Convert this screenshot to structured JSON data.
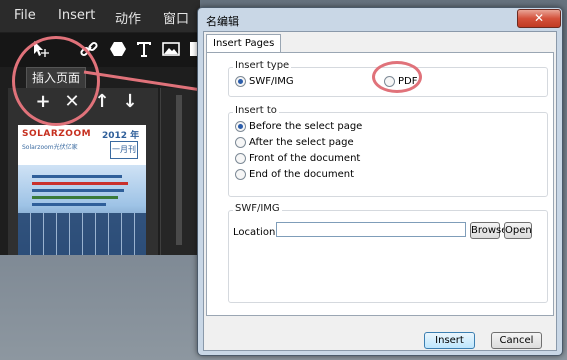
{
  "app": {
    "menu": [
      "File",
      "Insert",
      "动作",
      "窗口"
    ],
    "panel_title": "插入页面",
    "thumbnail": {
      "logo": "SOLARZOOM",
      "subtitle": "Solarzoom光伏亿家",
      "year": "2012 年",
      "issue": "一月刊"
    }
  },
  "dialog": {
    "title": "名编辑",
    "close_label": "✕",
    "tab_label": "Insert Pages",
    "insert_type": {
      "legend": "Insert type",
      "options": [
        "SWF/IMG",
        "PDF"
      ],
      "selected": "SWF/IMG"
    },
    "insert_to": {
      "legend": "Insert to",
      "options": [
        "Before the select page",
        "After the select page",
        "Front of the document",
        "End of the document"
      ],
      "selected": "Before the select page"
    },
    "swf_img": {
      "legend": "SWF/IMG",
      "location_label": "Location:",
      "location_value": "",
      "browse_label": "Browse",
      "open_label": "Open"
    },
    "insert_button": "Insert",
    "cancel_button": "Cancel"
  },
  "colors": {
    "highlight": "#e0727a",
    "selected_radio": "#2a5caa"
  }
}
